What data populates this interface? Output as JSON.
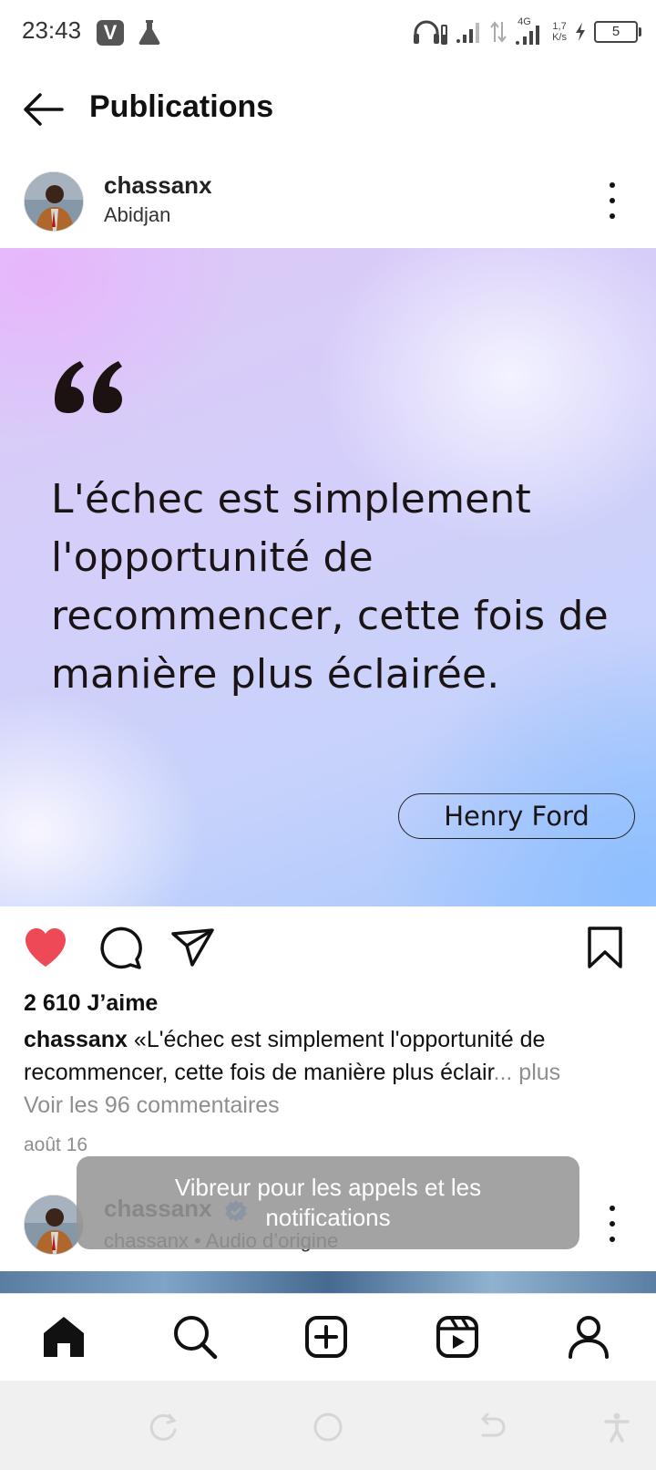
{
  "status_bar": {
    "time": "23:43",
    "app_badge": "V",
    "network": "4G",
    "speed_value": "1,7",
    "speed_unit": "K/s",
    "battery": "5"
  },
  "header": {
    "title": "Publications"
  },
  "post": {
    "username": "chassanx",
    "location": "Abidjan",
    "image": {
      "quote": "L'échec est simplement l'opportunité de recommencer, cette fois de manière plus éclairée.",
      "author": "Henry Ford"
    },
    "liked": true,
    "likes": "2 610 J’aime",
    "caption_user": "chassanx",
    "caption_text": "«L'échec est simplement l'opportunité de recommencer, cette fois de manière plus éclair",
    "caption_more": "... plus",
    "comments_link": "Voir les 96 commentaires",
    "date": "août 16"
  },
  "post2": {
    "username": "chassanx",
    "subtitle": "chassanx • Audio d’origine"
  },
  "toast": {
    "message": "Vibreur pour les appels et les notifications"
  },
  "colors": {
    "like": "#ed4956",
    "verified": "#3897f0",
    "muted": "#8e8e8e"
  }
}
